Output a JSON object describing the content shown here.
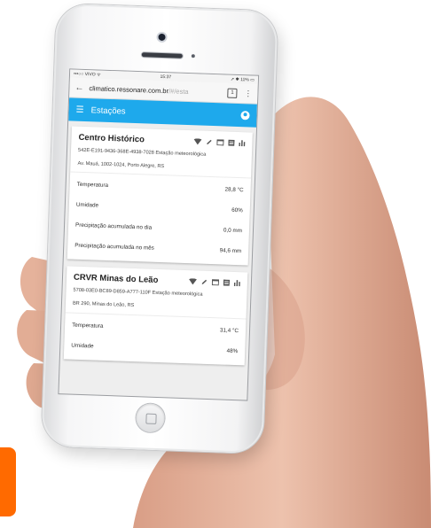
{
  "status_bar": {
    "carrier": "•••○○ VIVO ᯤ",
    "time": "15:37",
    "battery": "➚ ✱ 11% ▭"
  },
  "browser": {
    "url_main": "climatico.ressonare.com.br",
    "url_faded": "/#/esta",
    "tab_count": "1"
  },
  "app_bar": {
    "title": "Estações"
  },
  "stations": [
    {
      "name": "Centro Histórico",
      "id_line": "542E-E191-9436-368E-4938-7028  Estação meteorológica",
      "address": "Av. Mauá, 1002-1024, Porto Alegre, RS",
      "readings": [
        {
          "label": "Temperatura",
          "value": "28,8 °C"
        },
        {
          "label": "Umidade",
          "value": "60%"
        },
        {
          "label": "Precipitação acumulada no dia",
          "value": "0,0 mm"
        },
        {
          "label": "Precipitação acumulada no mês",
          "value": "94,6 mm"
        }
      ]
    },
    {
      "name": "CRVR Minas do Leão",
      "id_line": "5708-03E0-BC89-D859-A777-110F  Estação meteorológica",
      "address": "BR 290, Minas do Leão, RS",
      "readings": [
        {
          "label": "Temperatura",
          "value": "31,4 °C"
        },
        {
          "label": "Umidade",
          "value": "48%"
        }
      ]
    }
  ],
  "colors": {
    "app_bar": "#1ea9ec",
    "accent_tab": "#ff6a00",
    "skin": "#e7b8a0"
  },
  "icons": [
    "wifi-icon",
    "edit-icon",
    "calendar-icon",
    "list-icon",
    "bar-chart-icon"
  ]
}
